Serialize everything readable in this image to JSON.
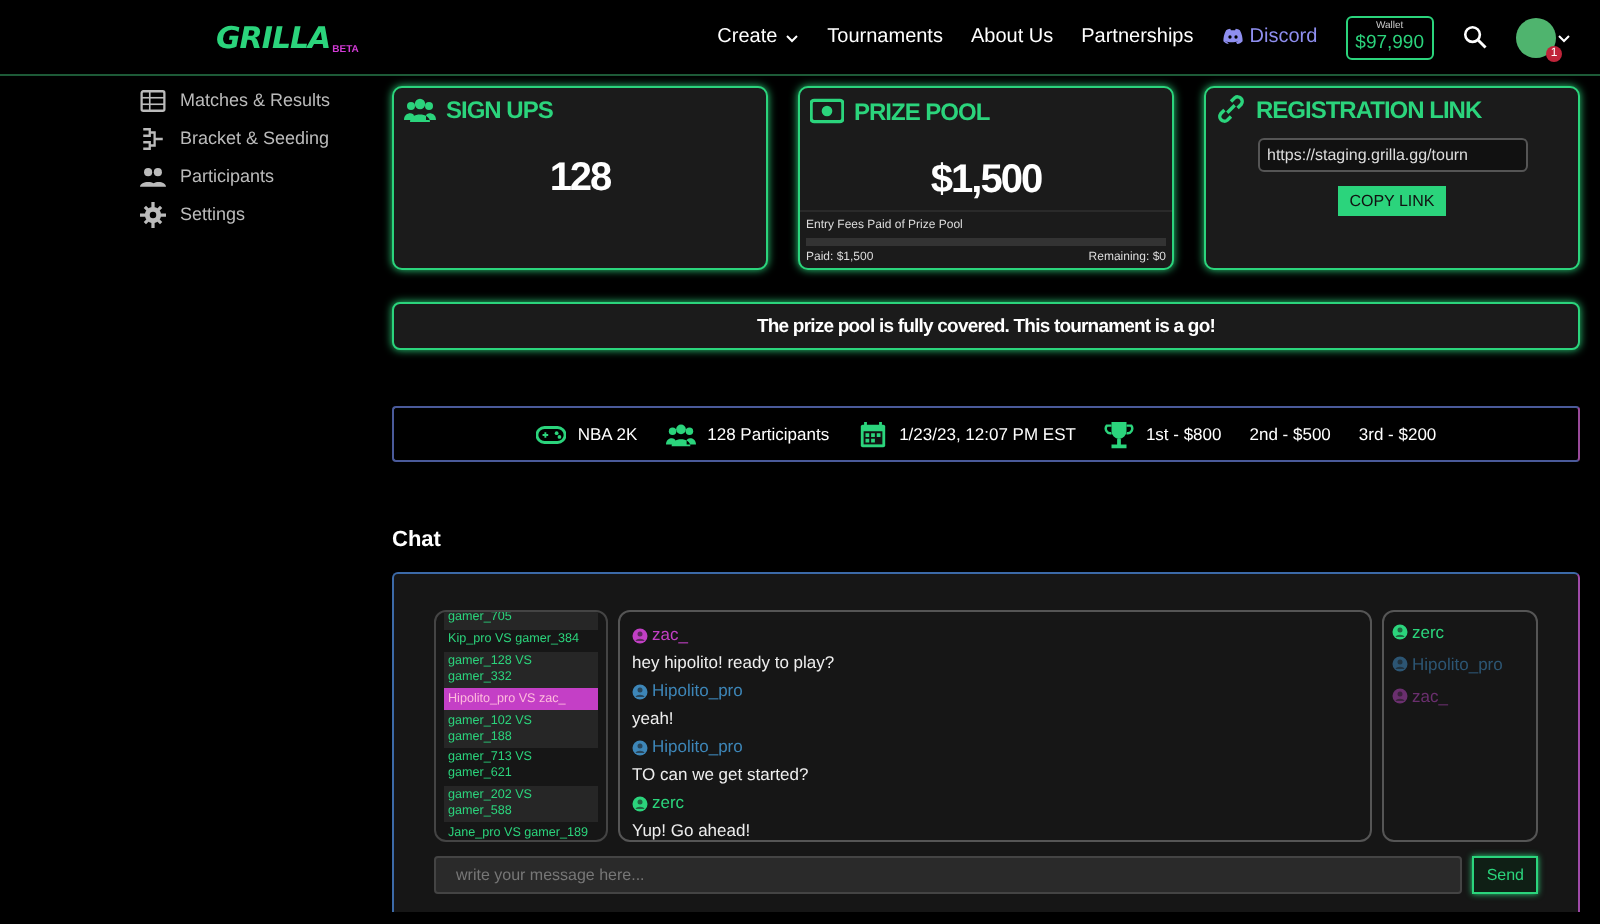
{
  "header": {
    "logo": "GRILLA",
    "logo_badge": "BETA",
    "nav": [
      {
        "label": "Create",
        "kind": "dropdown"
      },
      {
        "label": "Tournaments",
        "kind": "link"
      },
      {
        "label": "About Us",
        "kind": "link"
      },
      {
        "label": "Partnerships",
        "kind": "link"
      },
      {
        "label": "Discord",
        "kind": "discord"
      }
    ],
    "wallet": {
      "label": "Wallet",
      "amount": "$97,990"
    },
    "avatar_badge": "1"
  },
  "sidebar": {
    "items": [
      {
        "label": "Matches & Results",
        "kind": "table"
      },
      {
        "label": "Bracket & Seeding",
        "kind": "bracket"
      },
      {
        "label": "Participants",
        "kind": "people"
      },
      {
        "label": "Settings",
        "kind": "gear"
      }
    ]
  },
  "cards": {
    "sign_ups": {
      "title": "SIGN UPS",
      "value": "128"
    },
    "prize_pool": {
      "title": "PRIZE POOL",
      "value": "$1,500",
      "progress_label": "Entry Fees Paid of Prize Pool",
      "level": 1,
      "paid": "Paid: $1,500",
      "remaining": "Remaining: $0"
    },
    "registration": {
      "title": "REGISTRATION LINK",
      "url": "https://staging.grilla.gg/tourn",
      "button": "COPY LINK"
    }
  },
  "banner": "The prize pool is fully covered. This tournament is a go!",
  "info_bar": {
    "items": [
      {
        "kind": "game",
        "text": "NBA 2K"
      },
      {
        "kind": "participants",
        "text": "128 Participants"
      },
      {
        "kind": "date",
        "text": "1/23/23, 12:07 PM EST"
      },
      {
        "kind": "prize",
        "text": "1st - $800"
      },
      {
        "kind": "plain",
        "text": "2nd - $500"
      },
      {
        "kind": "plain",
        "text": "3rd - $200"
      }
    ]
  },
  "chat": {
    "title": "Chat",
    "matches": [
      {
        "label": "gamer_705",
        "selected": false
      },
      {
        "label": "Kip_pro VS gamer_384",
        "selected": false
      },
      {
        "label": "gamer_128 VS gamer_332",
        "selected": false
      },
      {
        "label": "Hipolito_pro VS zac_",
        "selected": true
      },
      {
        "label": "gamer_102 VS gamer_188",
        "selected": false
      },
      {
        "label": "gamer_713 VS gamer_621",
        "selected": false
      },
      {
        "label": "gamer_202 VS gamer_588",
        "selected": false
      },
      {
        "label": "Jane_pro VS gamer_189",
        "selected": false
      }
    ],
    "messages": [
      {
        "user": "zac_",
        "color": "#c13fc4",
        "text": "hey hipolito! ready to play?"
      },
      {
        "user": "Hipolito_pro",
        "color": "#3d86b8",
        "text": "yeah!"
      },
      {
        "user": "Hipolito_pro",
        "color": "#3d86b8",
        "text": "TO can we get started?"
      },
      {
        "user": "zerc",
        "color": "#2bd47c",
        "text": "Yup! Go ahead!"
      }
    ],
    "online": [
      {
        "name": "zerc",
        "color": "#2bd47c"
      },
      {
        "name": "Hipolito_pro",
        "color": "#2c5573"
      },
      {
        "name": "zac_",
        "color": "#6a2f6e"
      }
    ],
    "input": {
      "placeholder": "write your message here..."
    },
    "send": "Send"
  }
}
